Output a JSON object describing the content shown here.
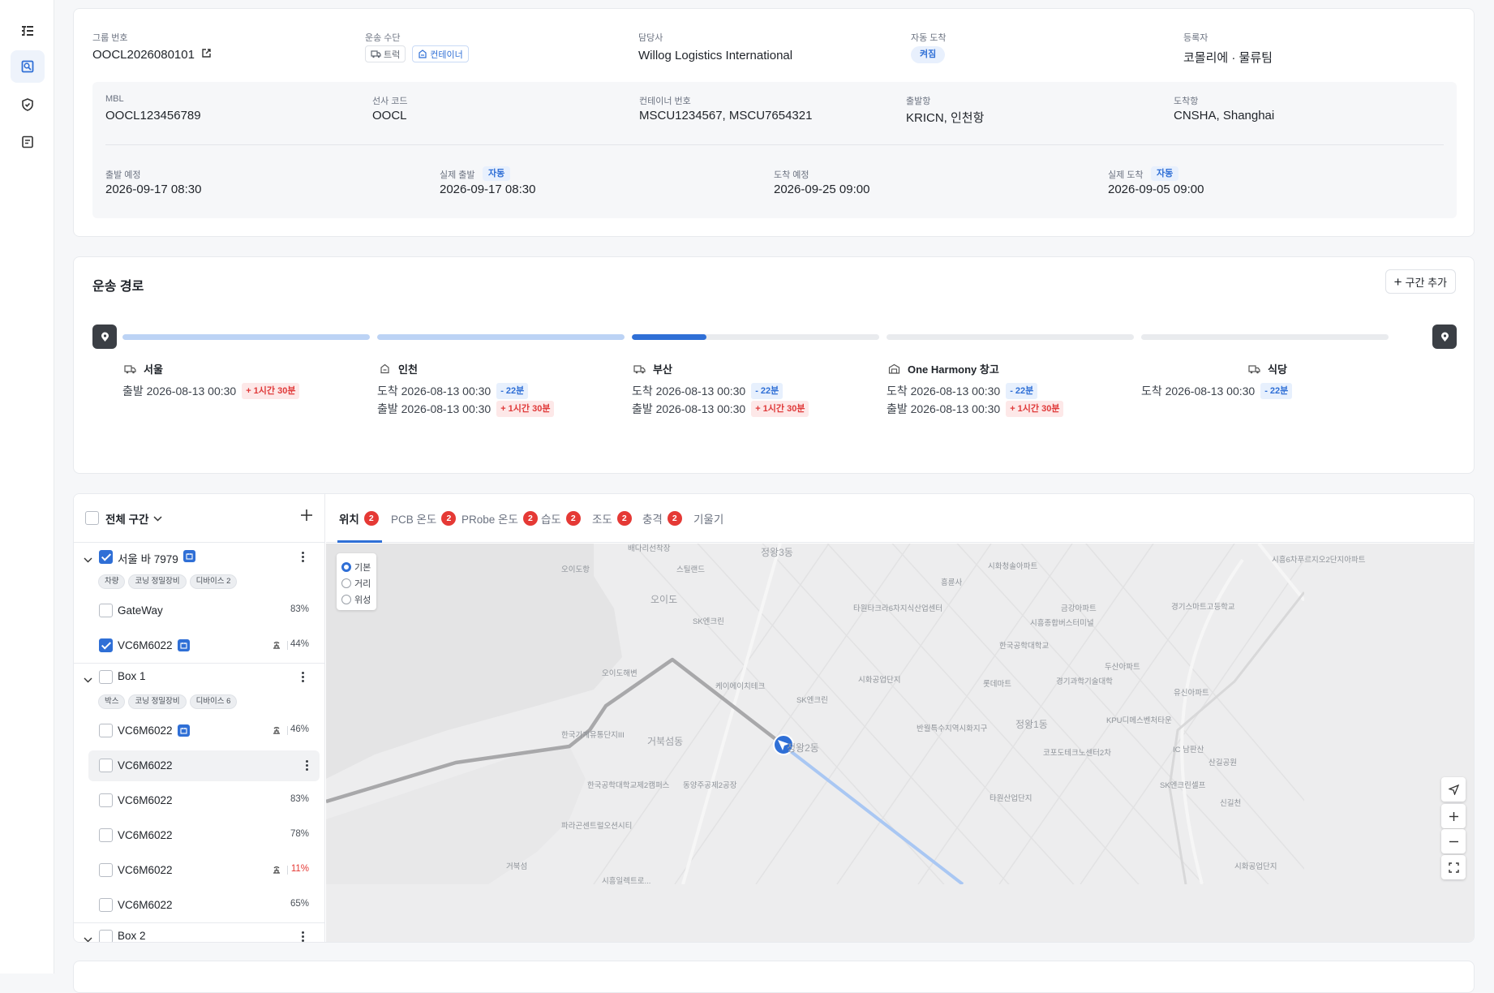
{
  "rail": {
    "items": [
      "list-tree-icon",
      "search-doc-icon",
      "shield-icon",
      "document-icon"
    ],
    "active": 1
  },
  "summary": {
    "group_no": {
      "label": "그룹 번호",
      "value": "OOCL2026080101"
    },
    "transport": {
      "label": "운송 수단",
      "options": [
        "트럭",
        "컨테이너"
      ]
    },
    "agent": {
      "label": "담당사",
      "value": "Willog Logistics International"
    },
    "auto_arrival": {
      "label": "자동 도착",
      "value": "켜짐"
    },
    "registrar": {
      "label": "등록자",
      "value": "코몰리에 · 물류팀"
    }
  },
  "details": {
    "mbl": {
      "label": "MBL",
      "value": "OOCL123456789"
    },
    "carrier_code": {
      "label": "선사 코드",
      "value": "OOCL"
    },
    "container_no": {
      "label": "컨테이너 번호",
      "value": "MSCU1234567, MSCU7654321"
    },
    "departure_port": {
      "label": "출발항",
      "value": "KRICN, 인천항"
    },
    "arrival_port": {
      "label": "도착항",
      "value": "CNSHA, Shanghai"
    },
    "etd": {
      "label": "출발 예정",
      "value": "2026-09-17 08:30"
    },
    "atd": {
      "label": "실제 출발",
      "value": "2026-09-17 08:30",
      "tag": "자동"
    },
    "eta": {
      "label": "도착 예정",
      "value": "2026-09-25 09:00"
    },
    "ata": {
      "label": "실제 도착",
      "value": "2026-09-05 09:00",
      "tag": "자동"
    }
  },
  "route": {
    "title": "운송 경로",
    "add_button": "구간 추가",
    "progress": [
      1.0,
      1.0,
      0.3,
      0.0,
      0.0
    ],
    "stops": [
      {
        "name": "서울",
        "icon": "truck-icon",
        "lines": [
          {
            "text": "출발 2026-08-13 00:30",
            "delta": "+ 1시간 30분",
            "kind": "red"
          }
        ]
      },
      {
        "name": "인천",
        "icon": "container-icon",
        "lines": [
          {
            "text": "도착 2026-08-13 00:30",
            "delta": "- 22분",
            "kind": "blue"
          },
          {
            "text": "출발 2026-08-13 00:30",
            "delta": "+ 1시간 30분",
            "kind": "red"
          }
        ]
      },
      {
        "name": "부산",
        "icon": "truck-icon",
        "lines": [
          {
            "text": "도착 2026-08-13 00:30",
            "delta": "- 22분",
            "kind": "blue"
          },
          {
            "text": "출발 2026-08-13 00:30",
            "delta": "+ 1시간 30분",
            "kind": "red"
          }
        ]
      },
      {
        "name": "One Harmony 창고",
        "icon": "warehouse-icon",
        "lines": [
          {
            "text": "도착 2026-08-13 00:30",
            "delta": "- 22분",
            "kind": "blue"
          },
          {
            "text": "출발 2026-08-13 00:30",
            "delta": "+ 1시간 30분",
            "kind": "red"
          }
        ]
      },
      {
        "name": "식당",
        "icon": "truck-icon",
        "lines": [
          {
            "text": "도착 2026-08-13 00:30",
            "delta": "- 22분",
            "kind": "blue"
          }
        ]
      }
    ]
  },
  "sidebar": {
    "scope_label": "전체 구간",
    "groups": [
      {
        "name": "서울 바 7979",
        "checked": true,
        "tags": [
          "차량",
          "코닝 정밀장비",
          "디바이스 2"
        ],
        "devices": [
          {
            "name": "GateWay",
            "checked": false,
            "badge": false,
            "signal": false,
            "pct": "83%",
            "low": false
          },
          {
            "name": "VC6M6022",
            "checked": true,
            "badge": true,
            "signal": true,
            "pct": "44%",
            "low": false
          }
        ]
      },
      {
        "name": "Box 1",
        "checked": false,
        "tags": [
          "박스",
          "코닝 정밀장비",
          "디바이스 6"
        ],
        "devices": [
          {
            "name": "VC6M6022",
            "checked": false,
            "badge": true,
            "signal": true,
            "pct": "46%",
            "low": false
          },
          {
            "name": "VC6M6022",
            "checked": false,
            "badge": false,
            "signal": false,
            "pct": "",
            "low": false,
            "hover": true
          },
          {
            "name": "VC6M6022",
            "checked": false,
            "badge": false,
            "signal": false,
            "pct": "83%",
            "low": false
          },
          {
            "name": "VC6M6022",
            "checked": false,
            "badge": false,
            "signal": false,
            "pct": "78%",
            "low": false
          },
          {
            "name": "VC6M6022",
            "checked": false,
            "badge": false,
            "signal": true,
            "pct": "11%",
            "low": true
          },
          {
            "name": "VC6M6022",
            "checked": false,
            "badge": false,
            "signal": false,
            "pct": "65%",
            "low": false
          }
        ]
      },
      {
        "name": "Box 2",
        "checked": false,
        "tags": [],
        "devices": []
      }
    ]
  },
  "tabs": [
    {
      "label": "위치",
      "count": "2",
      "active": true
    },
    {
      "label": "PCB 온도",
      "count": "2"
    },
    {
      "label": "PRobe 온도",
      "count": "2"
    },
    {
      "label": "습도",
      "count": "2"
    },
    {
      "label": "조도",
      "count": "2"
    },
    {
      "label": "충격",
      "count": "2"
    },
    {
      "label": "기울기",
      "count": ""
    }
  ],
  "map": {
    "layers": [
      "기본",
      "거리",
      "위성"
    ],
    "layer_selected": 0,
    "place_labels": [
      "배다리선착장",
      "오이도항",
      "스틸랜드",
      "오이도",
      "SK엔크린",
      "정왕3동",
      "흥륜사",
      "시화청솔아파트",
      "타원타크라6차지식산업센터",
      "금강아파트",
      "시흥종합버스터미널",
      "한국공학대학교",
      "경기스마트고등학교",
      "시흥6차푸르지오2단지아파트",
      "오이도해변",
      "케이에이치테크",
      "SK엔크린",
      "시화공업단지",
      "롯데마트",
      "경기과학기술대학",
      "두산아파트",
      "유신아파트",
      "한국기계유통단지III",
      "거북섬동",
      "반월특수지역시화지구",
      "정왕1동",
      "정왕2동",
      "KPU디메스벤처타운",
      "코포도테크노센터2차",
      "한국공학대학교제2캠퍼스",
      "동양주공제2공장",
      "파라곤센트럴오션시티",
      "타원산업단지",
      "SK엔크린셀프",
      "산길공원",
      "신길천",
      "거북섬",
      "시흥일렉트로...",
      "시화공업단지",
      "IC 남판산"
    ]
  },
  "colors": {
    "accent": "#2f6fd6",
    "danger": "#e53935",
    "route_done": "#bcd3f5"
  }
}
